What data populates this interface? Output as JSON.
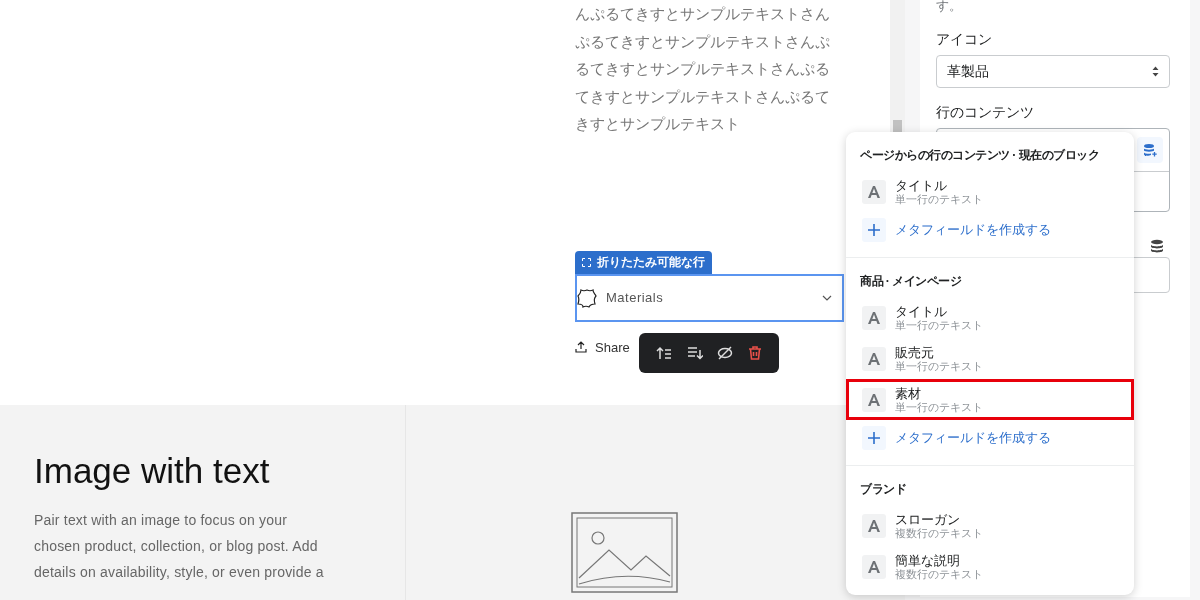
{
  "preview": {
    "body_text": "んぷるてきすとサンプルテキストさんぷるてきすとサンプルテキストさんぷるてきすとサンプルテキストさんぷるてきすとサンプルテキストさんぷるてきすとサンプルテキスト",
    "block_tag": "折りたたみ可能な行",
    "collapsible_row": {
      "title": "Materials"
    },
    "share": "Share"
  },
  "image_with_text": {
    "heading": "Image with text",
    "body": "Pair text with an image to focus on your chosen product, collection, or blog post. Add details on availability, style, or even provide a"
  },
  "settings": {
    "note": "す。",
    "icon_label": "アイコン",
    "icon_value": "革製品",
    "row_content_label": "行のコンテンツ"
  },
  "popover": {
    "sections": [
      {
        "title": "ページからの行のコンテンツ · 現在のブロック",
        "items": [
          {
            "kind": "field",
            "title": "タイトル",
            "subtitle": "単一行のテキスト",
            "selected": false
          },
          {
            "kind": "create",
            "label": "メタフィールドを作成する"
          }
        ]
      },
      {
        "title": "商品 · メインページ",
        "items": [
          {
            "kind": "field",
            "title": "タイトル",
            "subtitle": "単一行のテキスト",
            "selected": false
          },
          {
            "kind": "field",
            "title": "販売元",
            "subtitle": "単一行のテキスト",
            "selected": false
          },
          {
            "kind": "field",
            "title": "素材",
            "subtitle": "単一行のテキスト",
            "selected": true
          },
          {
            "kind": "create",
            "label": "メタフィールドを作成する"
          }
        ]
      },
      {
        "title": "ブランド",
        "items": [
          {
            "kind": "field",
            "title": "スローガン",
            "subtitle": "複数行のテキスト",
            "selected": false
          },
          {
            "kind": "field",
            "title": "簡単な説明",
            "subtitle": "複数行のテキスト",
            "selected": false
          }
        ]
      }
    ]
  }
}
